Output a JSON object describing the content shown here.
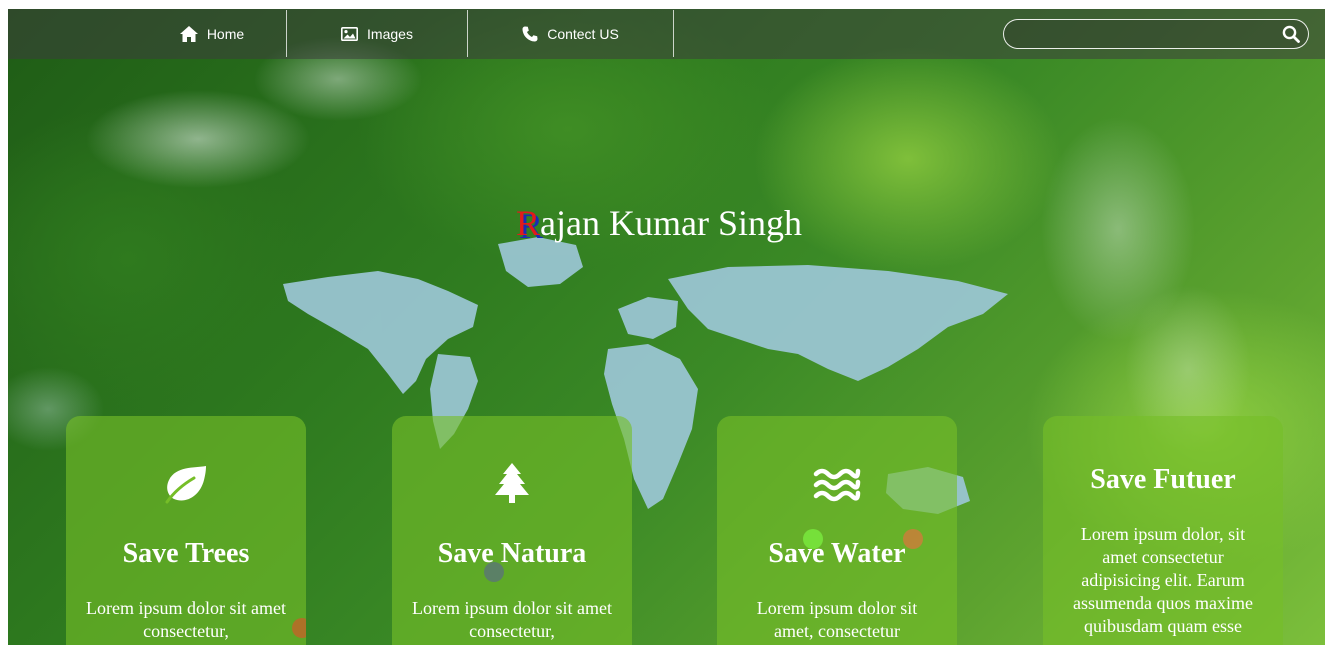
{
  "nav": {
    "items": [
      {
        "label": "Home",
        "icon": "home-icon"
      },
      {
        "label": "Images",
        "icon": "image-icon"
      },
      {
        "label": "Contect US",
        "icon": "phone-icon"
      }
    ],
    "search": {
      "value": "",
      "placeholder": "",
      "icon": "search-icon"
    }
  },
  "hero": {
    "initial": "R",
    "rest": "ajan Kumar Singh",
    "initial_color": "#e21b1b",
    "initial_shadow_color": "#1b2bb5"
  },
  "cards": [
    {
      "title": "Save Trees",
      "icon": "leaf-icon",
      "text": "Lorem ipsum dolor sit amet consectetur,"
    },
    {
      "title": "Save Natura",
      "icon": "tree-icon",
      "text": "Lorem ipsum dolor sit amet consectetur,"
    },
    {
      "title": "Save Water",
      "icon": "water-waves-icon",
      "text": "Lorem ipsum dolor sit amet, consectetur"
    },
    {
      "title": "Save Futuer",
      "icon": "",
      "text": "Lorem ipsum dolor, sit amet consectetur adipisicing elit. Earum assumenda quos maxime quibusdam quam esse"
    }
  ],
  "colors": {
    "card_background": "#76be28",
    "nav_background": "#3c3c3c",
    "text": "#ffffff"
  }
}
